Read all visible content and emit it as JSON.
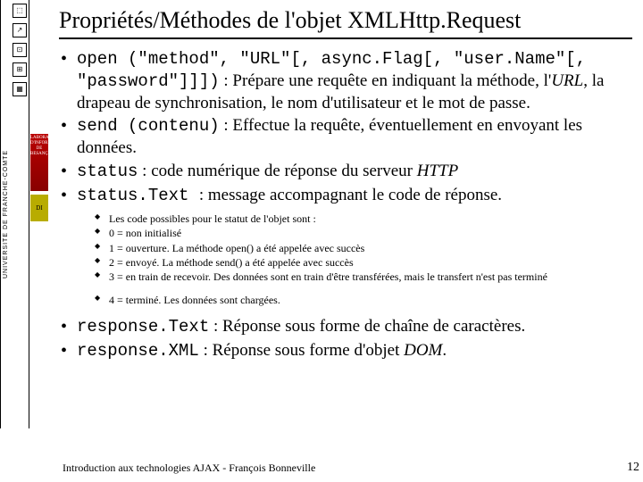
{
  "sidebar": {
    "univ": "UNIVERSITE DE FRANCHE-COMTE",
    "logo1": "LABORATOIRE D'INFORMATIQUE DE BESANÇON",
    "logo2": "DI"
  },
  "title": "Propriétés/Méthodes de l'objet XMLHttp.Request",
  "items": [
    {
      "code": "open (\"method\", \"URL\"[, async.Flag[, \"user.Name\"[, \"password\"]]])",
      "rest1": " : Prépare une requête en indiquant la méthode, l'",
      "it1": "URL",
      "rest2": ", la drapeau de synchronisation, le nom d'utilisateur et le mot de passe."
    },
    {
      "code": "send (contenu)",
      "rest1": " : Effectue la requête, éventuellement en envoyant les données."
    },
    {
      "code": "status",
      "rest1": " : code numérique de réponse du serveur ",
      "it1": "HTTP"
    },
    {
      "code": "status.Text ",
      "rest1": " : message accompagnant le code de réponse."
    }
  ],
  "sub": [
    "Les code possibles pour le statut de l'objet sont :",
    "0 = non initialisé",
    "1 = ouverture. La méthode open() a été appelée avec succès",
    "2 = envoyé. La méthode send() a été appelée avec succès",
    "3 = en train de recevoir. Des données sont en train d'être transférées, mais le transfert n'est pas terminé"
  ],
  "sub2": [
    "4 = terminé. Les données sont chargées."
  ],
  "items2": [
    {
      "code": "response.Text",
      "rest1": " : Réponse sous forme de chaîne de caractères."
    },
    {
      "code": "response.XML",
      "rest1": " : Réponse sous forme d'objet ",
      "it1": "DOM",
      "rest2": "."
    }
  ],
  "footer": "Introduction aux technologies AJAX - François Bonneville",
  "page": "12"
}
